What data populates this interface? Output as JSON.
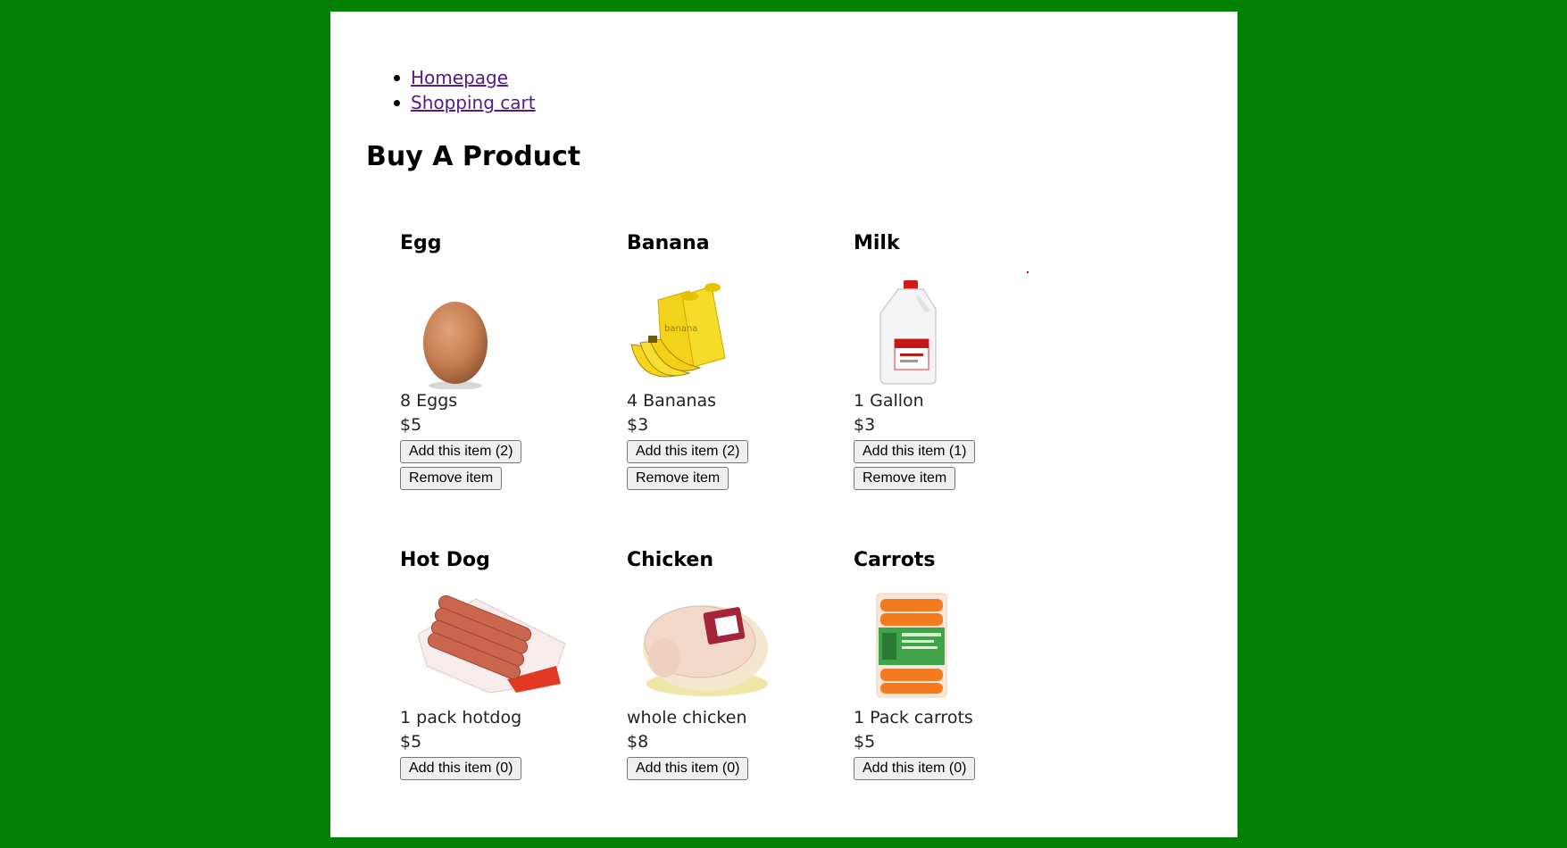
{
  "nav": {
    "homepage": "Homepage",
    "cart": "Shopping cart"
  },
  "title": "Buy A Product",
  "products": [
    {
      "name": "Egg",
      "desc": "8 Eggs",
      "price": "$5",
      "add_label": "Add this item (2)",
      "remove_label": "Remove item",
      "icon": "egg-icon"
    },
    {
      "name": "Banana",
      "desc": "4 Bananas",
      "price": "$3",
      "add_label": "Add this item (2)",
      "remove_label": "Remove item",
      "icon": "banana-icon"
    },
    {
      "name": "Milk",
      "desc": "1 Gallon",
      "price": "$3",
      "add_label": "Add this item (1)",
      "remove_label": "Remove item",
      "icon": "milk-jug-icon"
    },
    {
      "name": "Hot Dog",
      "desc": "1 pack hotdog",
      "price": "$5",
      "add_label": "Add this item (0)",
      "icon": "hotdog-pack-icon"
    },
    {
      "name": "Chicken",
      "desc": "whole chicken",
      "price": "$8",
      "add_label": "Add this item (0)",
      "icon": "whole-chicken-icon"
    },
    {
      "name": "Carrots",
      "desc": "1 Pack carrots",
      "price": "$5",
      "add_label": "Add this item (0)",
      "icon": "carrot-bag-icon"
    }
  ],
  "colors": {
    "background": "#028002",
    "panel": "#ffffff",
    "link": "#551a8b"
  }
}
